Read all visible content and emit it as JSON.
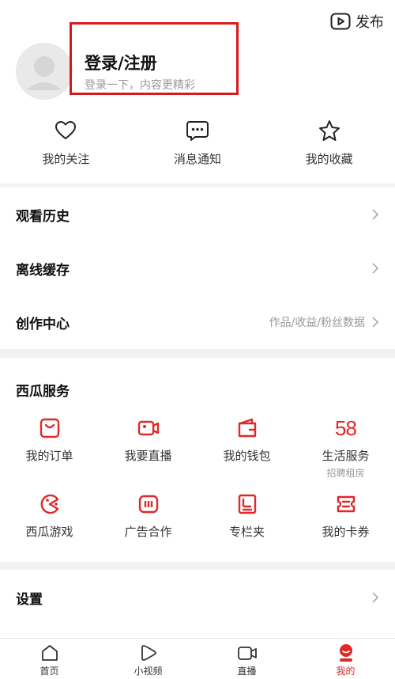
{
  "header": {
    "publish_label": "发布",
    "login_title": "登录/注册",
    "login_subtitle": "登录一下，内容更精彩"
  },
  "quick_actions": [
    {
      "label": "我的关注",
      "icon": "heart-icon"
    },
    {
      "label": "消息通知",
      "icon": "message-icon"
    },
    {
      "label": "我的收藏",
      "icon": "star-icon"
    }
  ],
  "list_items": [
    {
      "label": "观看历史",
      "right_text": ""
    },
    {
      "label": "离线缓存",
      "right_text": ""
    },
    {
      "label": "创作中心",
      "right_text": "作品/收益/粉丝数据"
    }
  ],
  "services": {
    "title": "西瓜服务",
    "items": [
      {
        "label": "我的订单",
        "sub": "",
        "icon": "order-icon"
      },
      {
        "label": "我要直播",
        "sub": "",
        "icon": "live-camera-icon"
      },
      {
        "label": "我的钱包",
        "sub": "",
        "icon": "wallet-icon"
      },
      {
        "label": "生活服务",
        "sub": "招聘租房",
        "icon": "58-icon",
        "icon_text": "58"
      },
      {
        "label": "西瓜游戏",
        "sub": "",
        "icon": "game-icon"
      },
      {
        "label": "广告合作",
        "sub": "",
        "icon": "ad-icon"
      },
      {
        "label": "专栏夹",
        "sub": "",
        "icon": "column-icon"
      },
      {
        "label": "我的卡券",
        "sub": "",
        "icon": "coupon-icon"
      }
    ]
  },
  "settings": {
    "label": "设置"
  },
  "bottom_nav": [
    {
      "label": "首页",
      "icon": "home-icon",
      "active": false
    },
    {
      "label": "小视频",
      "icon": "play-icon",
      "active": false
    },
    {
      "label": "直播",
      "icon": "camera-icon",
      "active": false
    },
    {
      "label": "我的",
      "icon": "profile-icon",
      "active": true
    }
  ],
  "colors": {
    "accent": "#e02828",
    "highlight_box": "#d71a1a"
  }
}
